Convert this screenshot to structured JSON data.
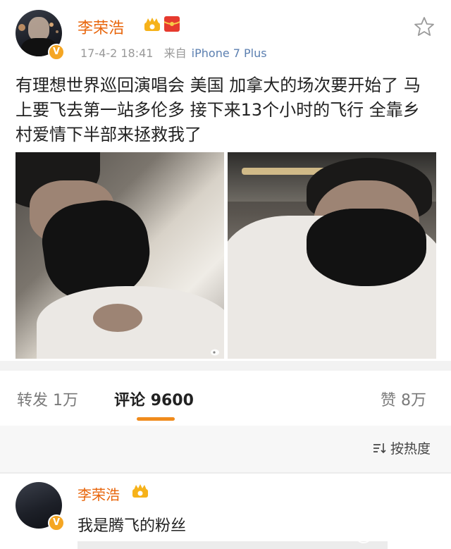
{
  "post": {
    "author": "李荣浩",
    "time": "17-4-2 18:41",
    "source_prefix": "来自",
    "source": "iPhone 7 Plus",
    "verified_badge": "V",
    "text": "有理想世界巡回演唱会 美国 加拿大的场次要开始了 马上要飞去第一站多伦多 接下来13个小时的飞行 全靠乡村爱情下半部来拯救我了",
    "icons": [
      "crown-member-icon",
      "red-packet-icon",
      "star-icon"
    ],
    "photos": [
      "photo-masked-man-lying",
      "photo-masked-man-selfie"
    ]
  },
  "actions": {
    "repost_label": "转发",
    "repost_count": "1万",
    "comment_label": "评论",
    "comment_count": "9600",
    "like_label": "赞",
    "like_count": "8万"
  },
  "sort": {
    "label": "按热度",
    "icon": "sort-icon"
  },
  "comment": {
    "author": "李荣浩",
    "verified_badge": "V",
    "text": "我是腾飞的粉丝"
  },
  "colors": {
    "username": "#e8660c",
    "accent_underline": "#f08b1c",
    "source_link": "#5b7fb0",
    "verified": "#f5a623"
  }
}
